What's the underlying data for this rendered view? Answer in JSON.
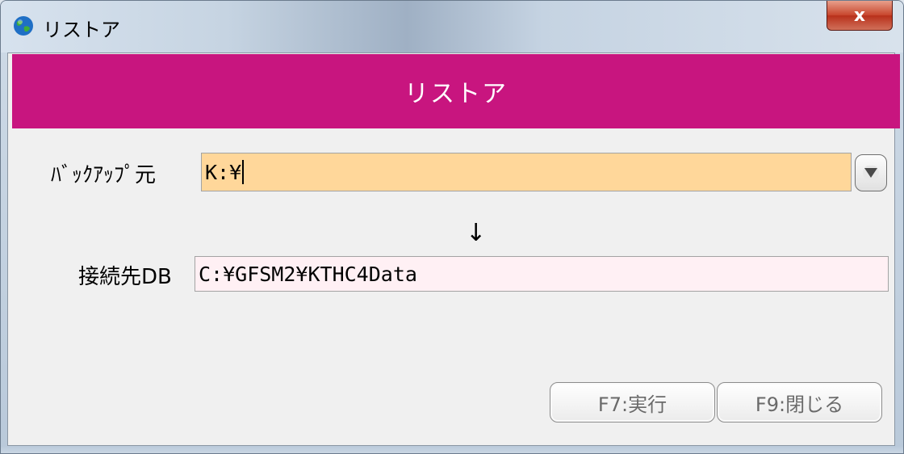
{
  "window": {
    "title": "リストア",
    "close_label": "x"
  },
  "header": {
    "title": "リストア"
  },
  "backup_source": {
    "label": "ﾊﾞｯｸｱｯﾌﾟ元",
    "value": "K:¥"
  },
  "arrow": "↓",
  "destination_db": {
    "label": "接続先DB",
    "value": "C:¥GFSM2¥KTHC4Data"
  },
  "buttons": {
    "run_label": "F7:実行",
    "close_label": "F9:閉じる"
  },
  "colors": {
    "header_band": "#c8157f",
    "source_field_bg": "#ffd79a",
    "destination_field_bg": "#fff0f4",
    "close_button": "#c7452c"
  },
  "icons": {
    "app": "globe-icon",
    "dropdown": "triangle-down-icon"
  }
}
